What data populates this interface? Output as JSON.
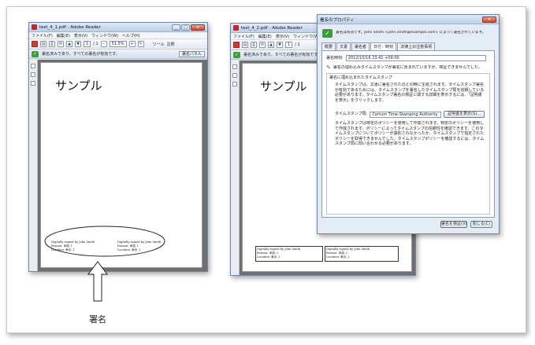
{
  "left_window": {
    "title": "test_4_1.pdf - Adobe Reader",
    "menu": [
      "ファイル(F)",
      "編集(E)",
      "表示(V)",
      "ウィンドウ(W)",
      "ヘルプ(H)"
    ],
    "toolbar": {
      "page_current": "1",
      "page_total": "/ 1",
      "zoom": "51.5%",
      "tools_label": "ツール",
      "comment_label": "注釈"
    },
    "signature_bar": {
      "message": "署名済みであり、すべての署名が有効です。",
      "panel_button": "署名パネル"
    },
    "page": {
      "heading": "サンプル",
      "signature_blocks": [
        {
          "line1": "Digitally signed by John Smith",
          "line2": "Reason: 承認_1",
          "line3": "Location: 東京_1"
        },
        {
          "line1": "Digitally signed by John Smith",
          "line2": "Reason: 承認_1",
          "line3": "Location: 東京_1"
        }
      ]
    }
  },
  "annotation": {
    "label": "署名"
  },
  "right_window": {
    "title": "test_4_2.pdf - Adobe Reader",
    "menu": [
      "ファイル(F)",
      "編集(E)",
      "表示(V)",
      "ウィンドウ(W)"
    ],
    "toolbar": {
      "page_current": "1",
      "page_total": "/ 1"
    },
    "signature_bar": {
      "message": "署名済みであり、すべての署名が有効です。"
    },
    "page": {
      "heading": "サンプル",
      "signature_blocks": [
        {
          "line1": "Digitally signed by John Smith",
          "line2": "Reason: 承認_2",
          "line3": "Location: 東京_2"
        },
        {
          "line1": "Digitally signed by John Smith",
          "line2": "Reason: 承認_2",
          "line3": "Location: 東京_2"
        }
      ]
    }
  },
  "dialog": {
    "title": "署名のプロパティ",
    "header_text": "署名は有効です。John Smith <john.smith@example.com> によって署名されています。",
    "tabs": [
      "概要",
      "文書",
      "署名者",
      "日付／時刻",
      "法律上の注意事項"
    ],
    "active_tab_index": 3,
    "signing_time_label": "署名時刻:",
    "signing_time_value": "2012/10/16 23:41 +09:00",
    "embedded_notice": "署名の埋め込みタイムスタンプが署名に含まれていますが、検証できませんでした。",
    "section_title": "署名に埋め込まれたタイムスタンプ",
    "paragraph1": "タイムスタンプは、文書に署名されたのと同時に生成されます。タイムスタンプ署名が有効であるためには、タイムスタンプを署名したタイムスタンプ局を信頼している必要があります。タイムスタンプ署名の検証に関する詳細を表示するには、「証明書を表示」をクリックします。",
    "authority_label": "タイムスタンプ局:",
    "authority_value": "Certum Time-Stamping Authority",
    "show_cert_button": "証明書を表示(S)...",
    "paragraph2": "タイムスタンプは特定のポリシーを使用して作成されます。特定のポリシーを使用して作成されます。ポリシーによってタイムスタンプの信頼性を確認できます。このタイムスタンプについてポリシーが識別されなかったか、タイムスタンプで指定されたポリシーを取得できませんでした。タイムスタンプポリシーを確認するには、タイムスタンプ局に問い合わせる必要があります。",
    "validate_button": "署名を検証(V)",
    "close_button": "閉じる(C)"
  }
}
